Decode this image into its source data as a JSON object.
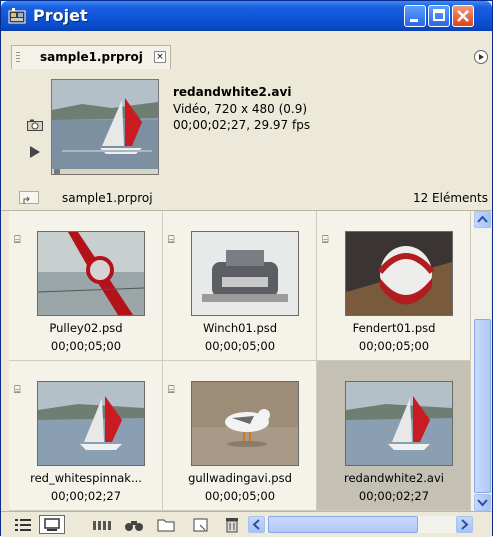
{
  "window": {
    "title": "Projet"
  },
  "tab": {
    "label": "sample1.prproj",
    "close": "×"
  },
  "preview": {
    "clip_name": "redandwhite2.avi",
    "info_line1": "Vidéo, 720 x 480 (0.9)",
    "info_line2": "00;00;02;27, 29.97 fps"
  },
  "pathbar": {
    "path": "sample1.prproj",
    "count": "12 Eléments"
  },
  "items": [
    {
      "name": "Pulley02.psd",
      "duration": "00;00;05;00"
    },
    {
      "name": "Winch01.psd",
      "duration": "00;00;05;00"
    },
    {
      "name": "Fendert01.psd",
      "duration": "00;00;05;00"
    },
    {
      "name": "red_whitespinnak...",
      "duration": "00;00;02;27"
    },
    {
      "name": "gullwadingavi.psd",
      "duration": "00;00;05;00"
    },
    {
      "name": "redandwhite2.avi",
      "duration": "00;00;02;27",
      "selected": true
    }
  ],
  "colors": {
    "titlebar": "#0f55d8",
    "selection": "#c4c0b3",
    "panel": "#ece9d8",
    "scroll": "#b0c8f6"
  }
}
